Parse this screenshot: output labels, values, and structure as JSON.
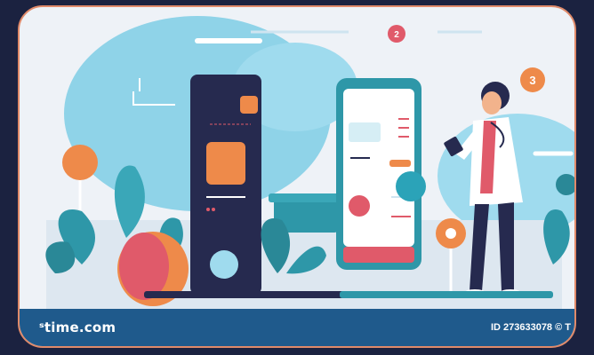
{
  "footer": {
    "brand": "ˢtime.com",
    "stock_id": "ID 273633078 © T"
  },
  "badges": {
    "top": "2",
    "right": "3"
  },
  "colors": {
    "background": "#1b2240",
    "border": "#e08a6a",
    "scene_bg": "#eef2f7",
    "blob_blue": "#8fd3e8",
    "dark_device": "#262a4f",
    "accent_orange": "#ee8a4a",
    "accent_pink": "#e05a6a",
    "accent_teal": "#2ba3b8",
    "leaf_teal": "#2e97a8",
    "footer_blue": "#1f5a8c"
  }
}
